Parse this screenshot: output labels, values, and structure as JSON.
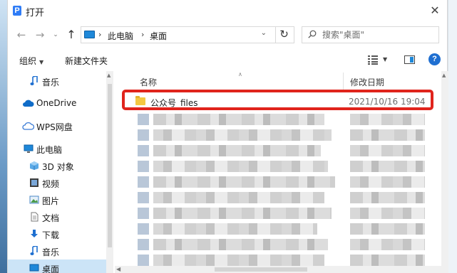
{
  "window": {
    "title": "打开",
    "close_glyph": "✕"
  },
  "nav_buttons": {
    "back": "←",
    "forward": "→",
    "recent": "⌄",
    "up": "↑"
  },
  "address": {
    "parts": [
      "此电脑",
      "桌面"
    ],
    "separator": "›",
    "dropdown": "⌄",
    "refresh_glyph": "↻"
  },
  "search": {
    "placeholder": "搜索\"桌面\""
  },
  "toolbar": {
    "organize_label": "组织",
    "new_folder_label": "新建文件夹",
    "help_label": "?"
  },
  "nav_pane": {
    "items": [
      {
        "label": "音乐",
        "icon": "music-note-icon"
      },
      {
        "label": "OneDrive",
        "icon": "cloud-icon"
      },
      {
        "label": "WPS网盘",
        "icon": "cloud-outline-icon"
      },
      {
        "label": "此电脑",
        "icon": "computer-icon"
      },
      {
        "label": "3D 对象",
        "icon": "cube-icon"
      },
      {
        "label": "视频",
        "icon": "film-icon"
      },
      {
        "label": "图片",
        "icon": "picture-icon"
      },
      {
        "label": "文档",
        "icon": "document-icon"
      },
      {
        "label": "下载",
        "icon": "download-arrow-icon"
      },
      {
        "label": "音乐",
        "icon": "music-note-icon"
      },
      {
        "label": "桌面",
        "icon": "desktop-icon",
        "selected": true
      }
    ]
  },
  "file_list": {
    "columns": {
      "name": "名称",
      "modified": "修改日期"
    },
    "rows": [
      {
        "name": "公众号_files",
        "modified": "2021/10/16 19:04",
        "type": "folder",
        "highlighted": true
      }
    ]
  },
  "colors": {
    "accent": "#1f6fd1",
    "highlight_border": "#e0241c",
    "selection": "#cce4f7",
    "folder": "#f4c842"
  }
}
